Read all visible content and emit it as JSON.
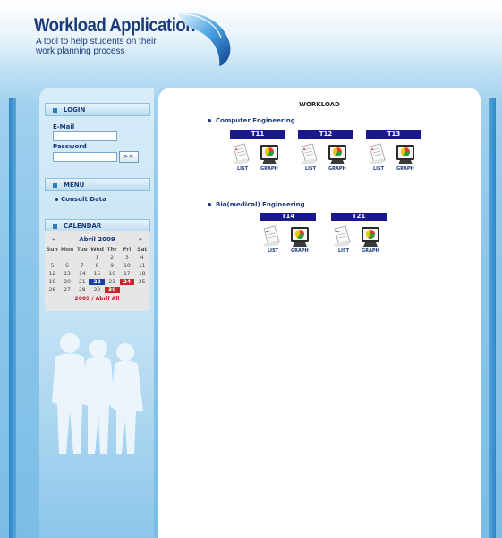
{
  "header": {
    "title": "Workload Application",
    "subtitle": "A tool to help students on their work planning process"
  },
  "login": {
    "heading": "LOGIN",
    "email_label": "E-Mail",
    "email_value": "",
    "password_label": "Password",
    "password_value": "",
    "submit_label": ">>"
  },
  "menu": {
    "heading": "MENU",
    "items": [
      {
        "label": "Consult Data"
      }
    ]
  },
  "calendar": {
    "heading": "CALENDAR",
    "prev": "«",
    "next": "»",
    "month": "Abril 2009",
    "weekdays": [
      "Sun",
      "Mon",
      "Tue",
      "Wed",
      "Thr",
      "Fri",
      "Sat"
    ],
    "weeks": [
      [
        "",
        "",
        "",
        "1",
        "2",
        "3",
        "4"
      ],
      [
        "5",
        "6",
        "7",
        "8",
        "9",
        "10",
        "11"
      ],
      [
        "12",
        "13",
        "14",
        "15",
        "16",
        "17",
        "18"
      ],
      [
        "19",
        "20",
        "21",
        "22",
        "23",
        "24",
        "25"
      ],
      [
        "26",
        "27",
        "28",
        "29",
        "30",
        "",
        ""
      ]
    ],
    "highlight_blue": [
      "22"
    ],
    "highlight_red": [
      "24",
      "30"
    ],
    "footer": "2009 / Abril All"
  },
  "main": {
    "title": "WORKLOAD",
    "sections": [
      {
        "name": "Computer Engineering",
        "groups": [
          {
            "code": "T11",
            "list_label": "LIST",
            "graph_label": "GRAPH"
          },
          {
            "code": "T12",
            "list_label": "LIST",
            "graph_label": "GRAPH"
          },
          {
            "code": "T13",
            "list_label": "LIST",
            "graph_label": "GRAPH"
          }
        ]
      },
      {
        "name": "Bio(medical) Engineering",
        "groups": [
          {
            "code": "T14",
            "list_label": "LIST",
            "graph_label": "GRAPH"
          },
          {
            "code": "T21",
            "list_label": "LIST",
            "graph_label": "GRAPH"
          }
        ]
      }
    ]
  },
  "colors": {
    "brand": "#1a3a7a",
    "group_header": "#1a1a8c",
    "accent_red": "#d0202a",
    "accent_blue": "#1a3fa6"
  },
  "icons": [
    "logo-swoosh-icon",
    "list-document-icon",
    "graph-monitor-icon",
    "students-silhouette-icon"
  ]
}
